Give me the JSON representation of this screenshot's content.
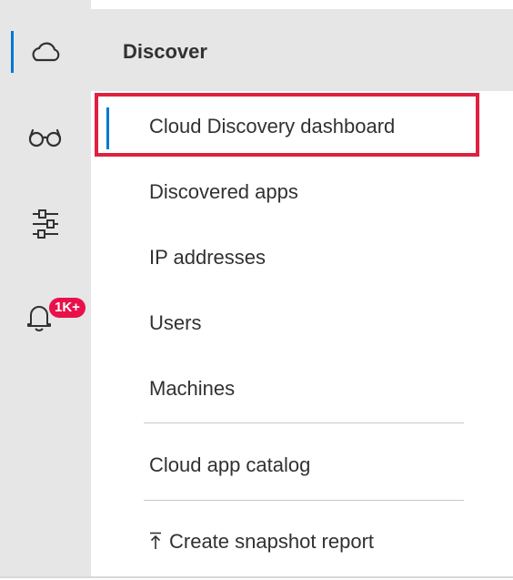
{
  "header": {
    "title": "Discover"
  },
  "rail": {
    "items": [
      {
        "name": "cloud-icon",
        "active": true
      },
      {
        "name": "glasses-icon",
        "active": false
      },
      {
        "name": "sliders-icon",
        "active": false
      },
      {
        "name": "bell-icon",
        "active": false
      }
    ],
    "alerts_badge": "1K+"
  },
  "menu": {
    "items": [
      {
        "label": "Cloud Discovery dashboard",
        "selected": true
      },
      {
        "label": "Discovered apps"
      },
      {
        "label": "IP addresses"
      },
      {
        "label": "Users"
      },
      {
        "label": "Machines"
      }
    ],
    "catalog": {
      "label": "Cloud app catalog"
    },
    "snapshot": {
      "label": "Create snapshot report",
      "icon": "upload-arrow-icon"
    }
  },
  "colors": {
    "accent": "#0078d4",
    "highlight": "#e0203f",
    "badge": "#e8114b",
    "rail_bg": "#e6e6e6"
  }
}
